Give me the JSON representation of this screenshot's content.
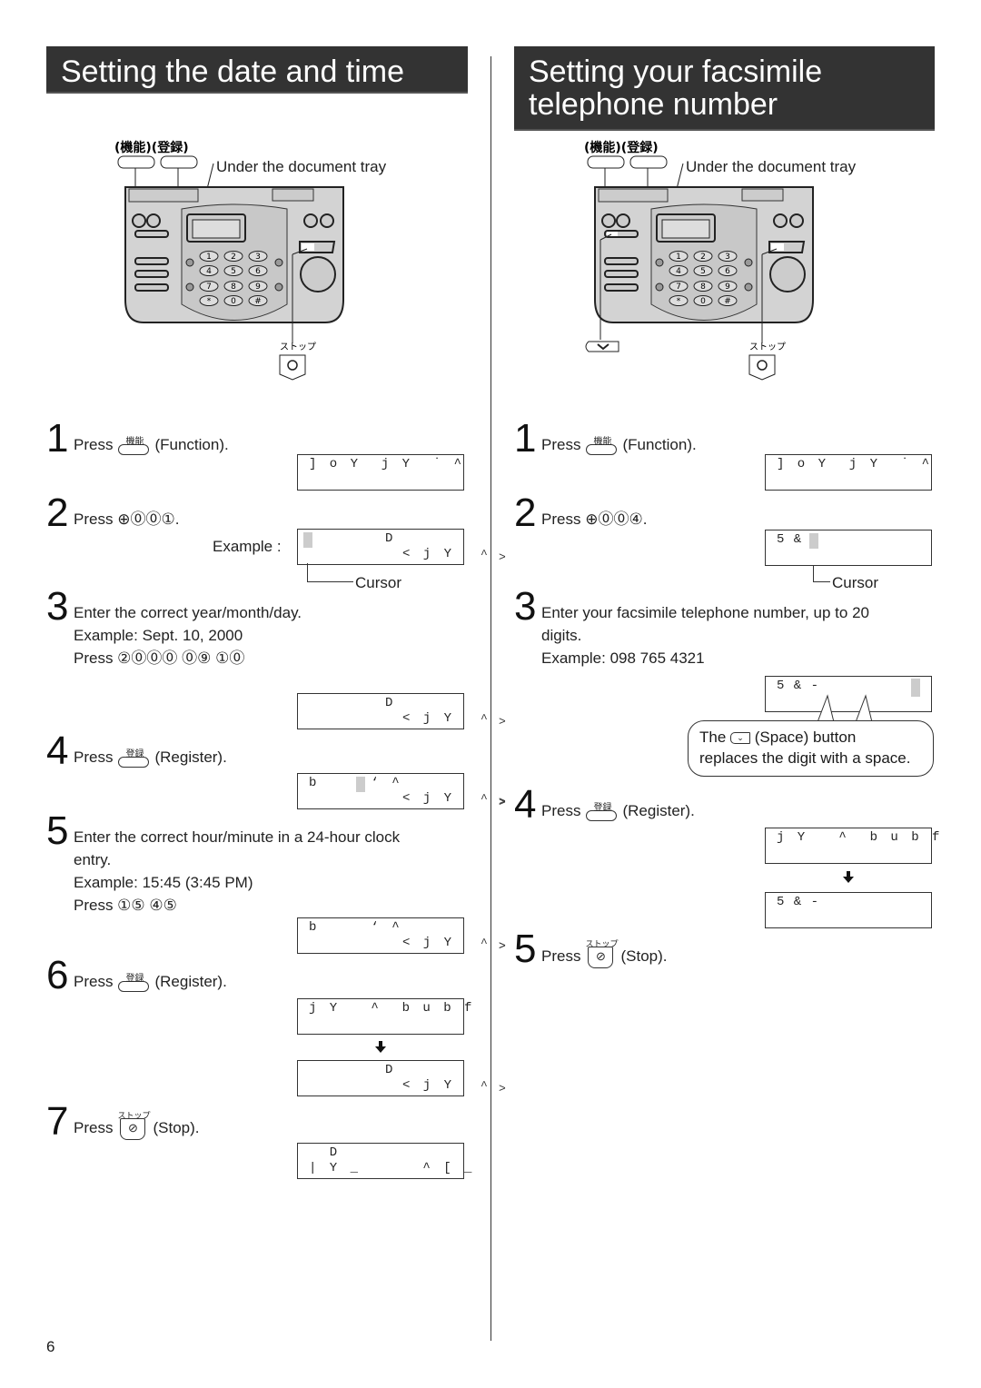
{
  "left": {
    "title": "Setting the date and time",
    "diagram": {
      "button_labels": [
        "機能",
        "登録"
      ],
      "tray_label": "Under the document tray",
      "stop_label": "ストップ",
      "keypad": [
        "1",
        "2",
        "3",
        "4",
        "5",
        "6",
        "7",
        "8",
        "9",
        "*",
        "0",
        "#"
      ]
    },
    "steps": [
      {
        "num": "1",
        "text": "Press",
        "key": "機能",
        "after": "(Function)."
      },
      {
        "num": "2",
        "text": "Press",
        "keys": "⊕⓪⓪①",
        "after": "."
      },
      {
        "num": "3",
        "lines": [
          "Enter the correct year/month/day.",
          "Example: Sept. 10, 2000",
          "Press ②⓪⓪⓪  ⓪⑨  ①⓪"
        ]
      },
      {
        "num": "4",
        "text": "Press",
        "key": "登録",
        "after": "(Register)."
      },
      {
        "num": "5",
        "lines": [
          "Enter the correct hour/minute in a 24-hour clock",
          "entry.",
          "Example: 15:45 (3:45 PM)",
          "Press ①⑤  ④⑤"
        ]
      },
      {
        "num": "6",
        "text": "Press",
        "key": "登録",
        "after": "(Register)."
      },
      {
        "num": "7",
        "text": "Press",
        "key": "ストップ",
        "after": "(Stop)."
      }
    ],
    "example_label": "Example :",
    "cursor_label": "Cursor",
    "lcds": [
      {
        "line1": "] o Y  j Y  ˙ ^",
        "line2": ""
      },
      {
        "center1": "D",
        "right2": "< j Y"
      },
      {
        "center1": "D",
        "right2": "< j Y"
      },
      {
        "line1": "b     ‘ ^",
        "right2": "< j Y"
      },
      {
        "line1": "b     ‘ ^",
        "right2": "< j Y"
      },
      {
        "line1": "j Y   ^  b u b f",
        "line2": ""
      },
      {
        "center1": "D",
        "right2": "< j Y"
      },
      {
        "line1": "  D",
        "line2": "| Y _      ^ [ _"
      }
    ],
    "side_marks": [
      "^",
      ">"
    ]
  },
  "right": {
    "title_line1": "Setting your facsimile",
    "title_line2": "telephone number",
    "diagram": {
      "button_labels": [
        "機能",
        "登録"
      ],
      "tray_label": "Under the document tray",
      "stop_label": "ストップ",
      "space_key": "space-button"
    },
    "steps": [
      {
        "num": "1",
        "text": "Press",
        "key": "機能",
        "after": "(Function)."
      },
      {
        "num": "2",
        "text": "Press",
        "keys": "⊕⓪⓪④",
        "after": "."
      },
      {
        "num": "3",
        "lines": [
          "Enter your facsimile telephone number, up to 20",
          "digits.",
          "Example: 098 765 4321"
        ]
      },
      {
        "num": "4",
        "text": "Press",
        "key": "登録",
        "after": "(Register)."
      },
      {
        "num": "5",
        "text": "Press",
        "key": "ストップ",
        "after": "(Stop)."
      }
    ],
    "cursor_label": "Cursor",
    "callout": {
      "line1_pre": "The",
      "line1_post": "(Space) button",
      "line2": "replaces the digit with a space."
    },
    "lcds": [
      {
        "line1": "] o Y  j Y  ˙ ^",
        "line2": ""
      },
      {
        "line1": "5 & -",
        "line2": ""
      },
      {
        "line1": "5 & -",
        "line2": ""
      },
      {
        "line1": "j Y   ^  b u b f",
        "line2": ""
      },
      {
        "line1": "5 & -",
        "line2": ""
      }
    ]
  },
  "page_number": "6"
}
